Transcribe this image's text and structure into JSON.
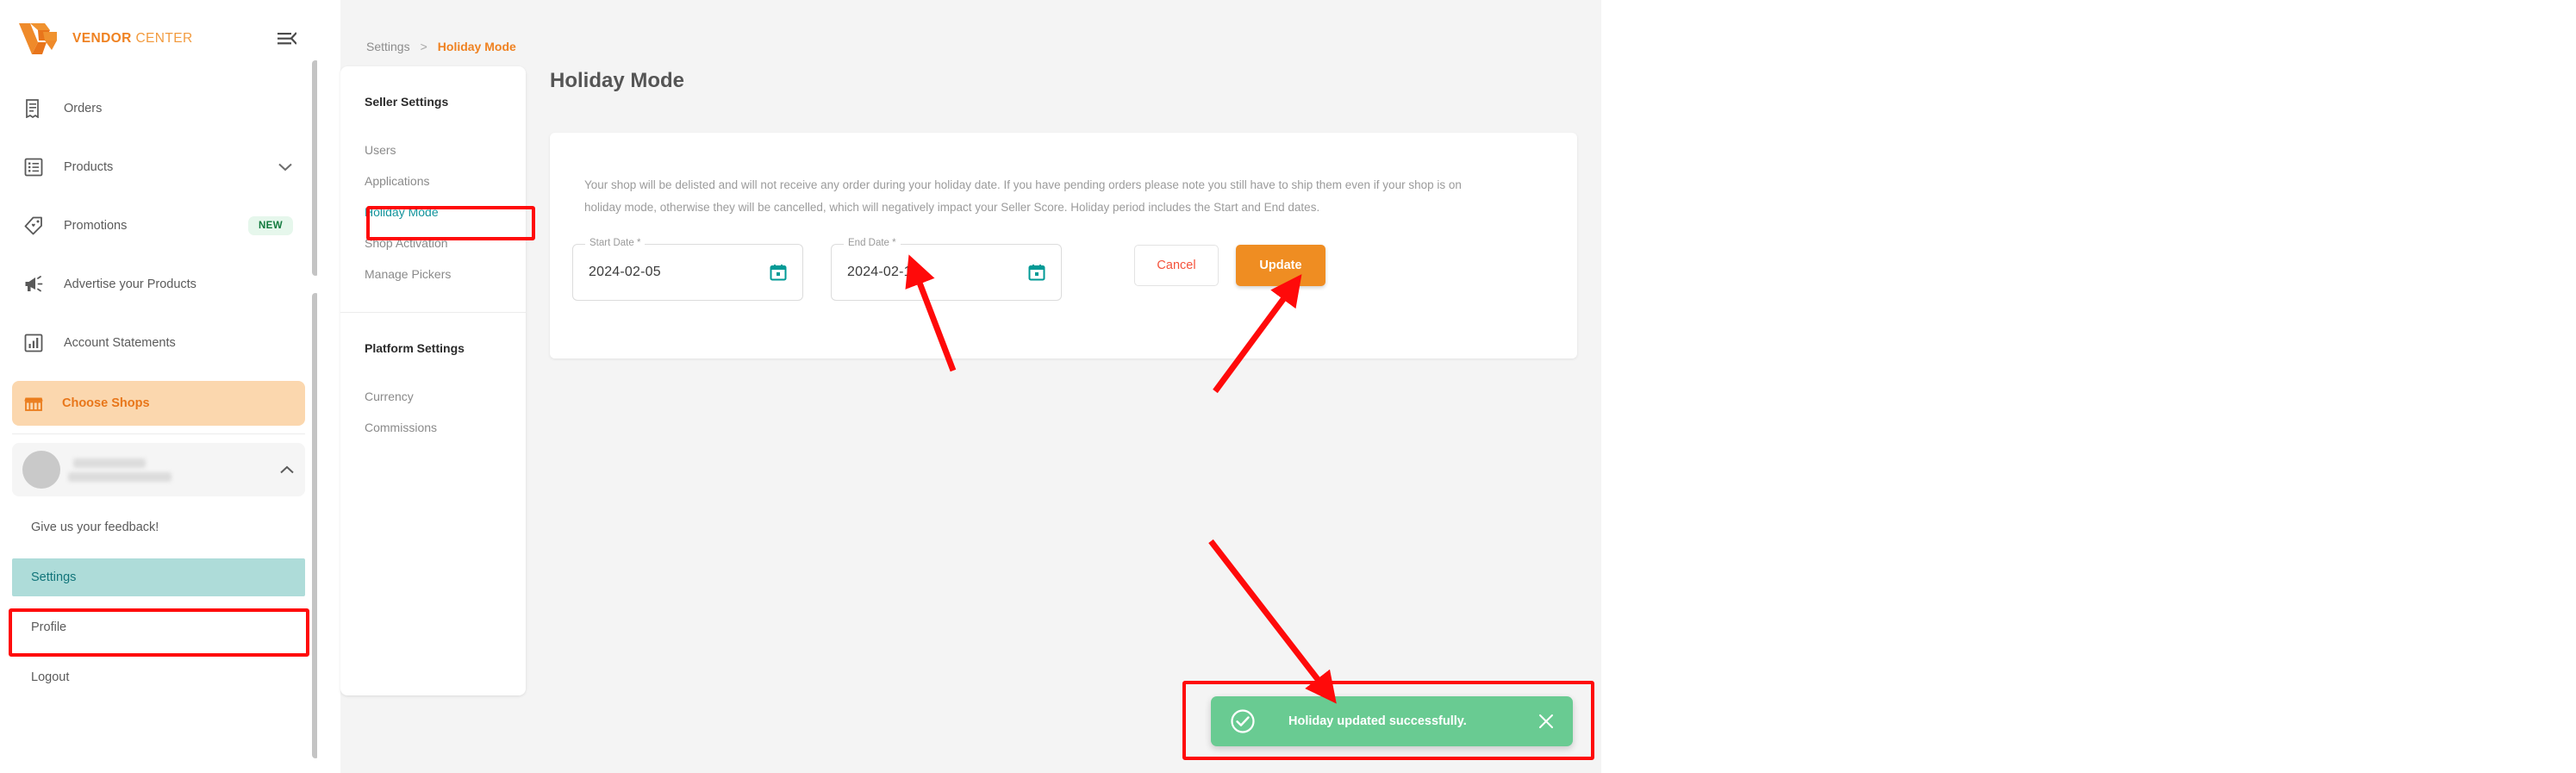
{
  "brand": {
    "name_bold": "VENDOR",
    "name_light": "CENTER",
    "logo_icon": "vendor-center-logo",
    "collapse_icon": "collapse-sidebar-icon"
  },
  "sidebar": {
    "items": [
      {
        "label": "Orders",
        "icon": "receipt-icon"
      },
      {
        "label": "Products",
        "icon": "list-icon",
        "chevron": "chevron-down-icon"
      },
      {
        "label": "Promotions",
        "icon": "tag-icon",
        "badge": "NEW"
      },
      {
        "label": "Advertise your Products",
        "icon": "megaphone-icon"
      },
      {
        "label": "Account Statements",
        "icon": "bar-chart-icon"
      }
    ],
    "choose_shops": {
      "label": "Choose Shops",
      "icon": "storefront-icon"
    },
    "profile": {
      "expand_icon": "chevron-up-icon",
      "avatar": "user-avatar"
    },
    "account_items": [
      {
        "label": "Give us your feedback!",
        "active": false
      },
      {
        "label": "Settings",
        "active": true
      },
      {
        "label": "Profile",
        "active": false
      },
      {
        "label": "Logout",
        "active": false
      }
    ]
  },
  "settings_nav": {
    "groups": [
      {
        "title": "Seller Settings",
        "links": [
          {
            "label": "Users",
            "active": false
          },
          {
            "label": "Applications",
            "active": false
          },
          {
            "label": "Holiday Mode",
            "active": true
          },
          {
            "label": "Shop Activation",
            "active": false
          },
          {
            "label": "Manage Pickers",
            "active": false
          }
        ]
      },
      {
        "title": "Platform Settings",
        "links": [
          {
            "label": "Currency",
            "active": false
          },
          {
            "label": "Commissions",
            "active": false
          }
        ]
      }
    ]
  },
  "breadcrumb": {
    "root": "Settings",
    "separator": ">",
    "current": "Holiday Mode"
  },
  "page": {
    "title": "Holiday Mode",
    "description": "Your shop will be delisted and will not receive any order during your holiday date. If you have pending orders please note you still have to ship them even if your shop is on holiday mode, otherwise they will be cancelled, which will negatively impact your Seller Score. Holiday period includes the Start and End dates."
  },
  "form": {
    "start_date": {
      "legend": "Start Date *",
      "value": "2024-02-05",
      "icon": "calendar-icon"
    },
    "end_date": {
      "legend": "End Date *",
      "value": "2024-02-17",
      "icon": "calendar-icon"
    },
    "cancel_label": "Cancel",
    "update_label": "Update"
  },
  "toast": {
    "message": "Holiday updated successfully.",
    "status_icon": "check-circle-icon",
    "close_icon": "close-icon"
  },
  "colors": {
    "brand_orange": "#ef8222",
    "primary_button": "#ef8d22",
    "active_teal": "#14939b",
    "active_highlight": "#aedcd9",
    "toast_green": "#69cb92",
    "annotation_red": "#ff0a0a",
    "badge_green_text": "#127a3e",
    "choose_shops_bg": "#fbd7ae"
  }
}
